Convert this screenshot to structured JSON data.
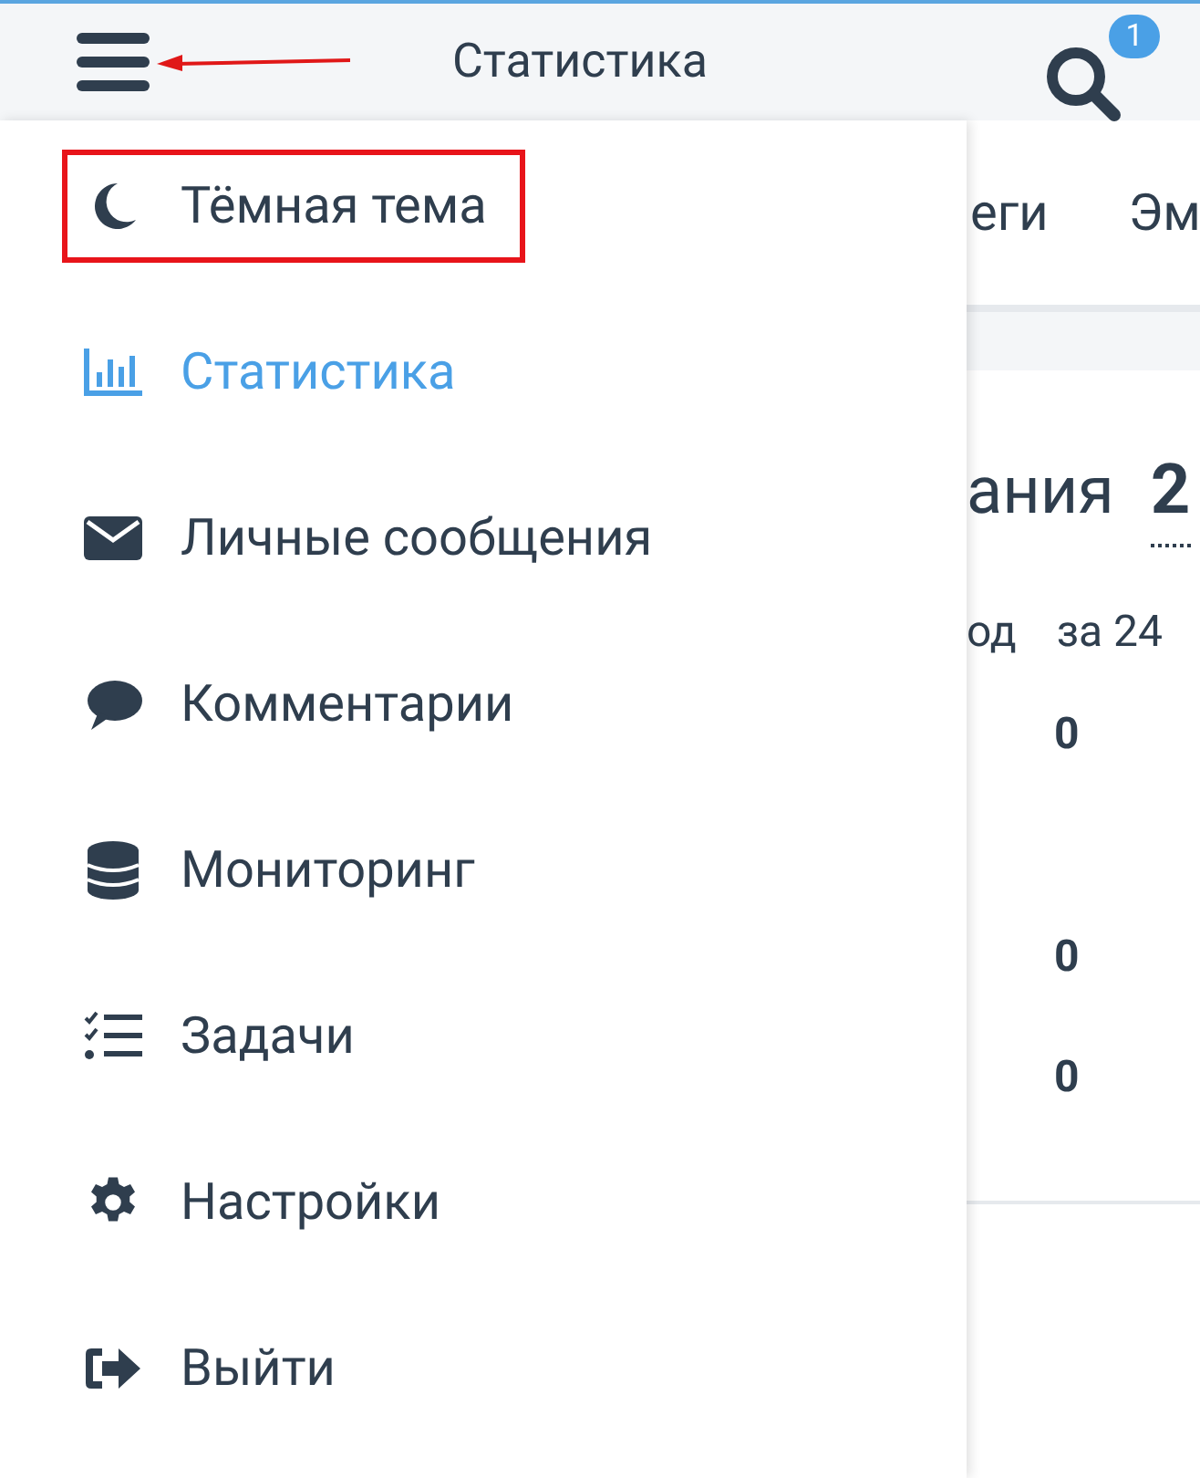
{
  "header": {
    "title": "Статистика",
    "search_badge": "1"
  },
  "drawer": {
    "items": [
      {
        "kind": "moon",
        "label": "Тёмная тема",
        "selected": false,
        "highlighted": true
      },
      {
        "kind": "chart",
        "label": "Статистика",
        "selected": true,
        "highlighted": false
      },
      {
        "kind": "mail",
        "label": "Личные сообщения",
        "selected": false,
        "highlighted": false
      },
      {
        "kind": "comment",
        "label": "Комментарии",
        "selected": false,
        "highlighted": false
      },
      {
        "kind": "database",
        "label": "Мониторинг",
        "selected": false,
        "highlighted": false
      },
      {
        "kind": "tasks",
        "label": "Задачи",
        "selected": false,
        "highlighted": false
      },
      {
        "kind": "gear",
        "label": "Настройки",
        "selected": false,
        "highlighted": false
      },
      {
        "kind": "logout",
        "label": "Выйти",
        "selected": false,
        "highlighted": false
      }
    ]
  },
  "background": {
    "tabs": [
      "еги",
      "Эм"
    ],
    "heading": "ания",
    "heading_value": "2",
    "columns": [
      "од",
      "за 24"
    ],
    "values": [
      "0",
      "0",
      "0"
    ]
  }
}
